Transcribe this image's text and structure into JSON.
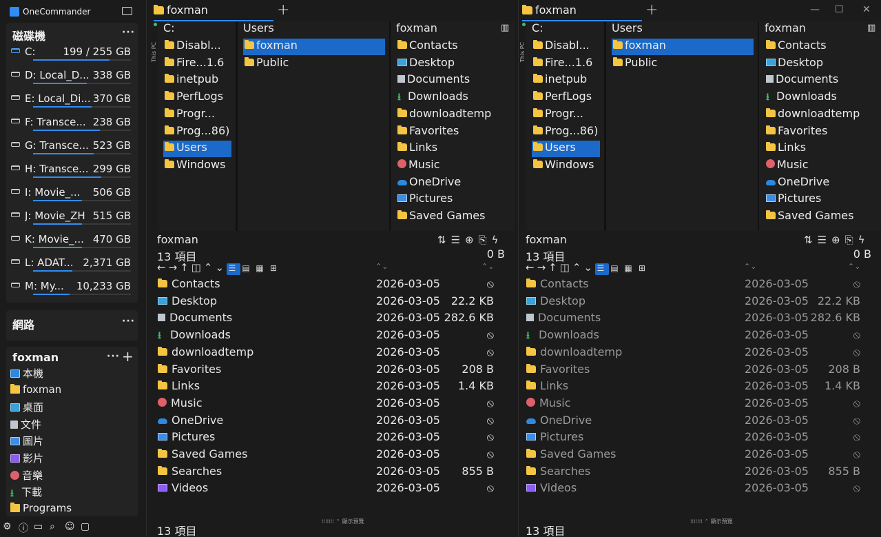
{
  "app": {
    "title": "OneCommander"
  },
  "sidebar": {
    "drives_title": "磁碟機",
    "drives": [
      {
        "label": "C:",
        "size": "199 / 255 GB",
        "fill": 0.78,
        "system": true
      },
      {
        "label": "D: Local_D...",
        "size": "338 GB",
        "fill": 0.55
      },
      {
        "label": "E: Local_Di...",
        "size": "370 GB",
        "fill": 0.6
      },
      {
        "label": "F: Transce...",
        "size": "238 GB",
        "fill": 0.68
      },
      {
        "label": "G: Transce...",
        "size": "523 GB",
        "fill": 0.62
      },
      {
        "label": "H: Transce...",
        "size": "299 GB",
        "fill": 0.7
      },
      {
        "label": "I:  Movie_...",
        "size": "506 GB",
        "fill": 0.5
      },
      {
        "label": "J:  Movie_ZH",
        "size": "515 GB",
        "fill": 0.5
      },
      {
        "label": "K: Movie_...",
        "size": "470 GB",
        "fill": 0.5
      },
      {
        "label": "L: ADAT...",
        "size": "2,371 GB",
        "fill": 0.4
      },
      {
        "label": "M: My...",
        "size": "10,233 GB",
        "fill": 0.37
      }
    ],
    "network_title": "網路",
    "user_title": "foxman",
    "nav": [
      {
        "label": "本機",
        "icon": "pc"
      },
      {
        "label": "foxman",
        "icon": "fold"
      },
      {
        "label": "桌面",
        "icon": "desk"
      },
      {
        "label": "文件",
        "icon": "doc"
      },
      {
        "label": "圖片",
        "icon": "pic"
      },
      {
        "label": "影片",
        "icon": "vid"
      },
      {
        "label": "音樂",
        "icon": "music"
      },
      {
        "label": "下載",
        "icon": "dl"
      },
      {
        "label": "Programs",
        "icon": "fold"
      }
    ]
  },
  "pane": {
    "tab_label": "foxman",
    "col1_head": "C:",
    "col1_items": [
      {
        "label": "Disabl...",
        "icon": "fold"
      },
      {
        "label": "Fire...1.6",
        "icon": "fold"
      },
      {
        "label": "inetpub",
        "icon": "fold"
      },
      {
        "label": "PerfLogs",
        "icon": "fold"
      },
      {
        "label": "Progr...",
        "icon": "fold"
      },
      {
        "label": "Prog...86)",
        "icon": "fold"
      },
      {
        "label": "Users",
        "icon": "fold",
        "selected": true
      },
      {
        "label": "Windows",
        "icon": "fold"
      }
    ],
    "col2_head": "Users",
    "col2_items": [
      {
        "label": "foxman",
        "icon": "fold",
        "selected": true
      },
      {
        "label": "Public",
        "icon": "fold"
      }
    ],
    "col3_head": "foxman",
    "col3_items": [
      {
        "label": "Contacts",
        "icon": "fold"
      },
      {
        "label": "Desktop",
        "icon": "desk"
      },
      {
        "label": "Documents",
        "icon": "doc"
      },
      {
        "label": "Downloads",
        "icon": "dl"
      },
      {
        "label": "downloadtemp",
        "icon": "fold"
      },
      {
        "label": "Favorites",
        "icon": "fold"
      },
      {
        "label": "Links",
        "icon": "fold"
      },
      {
        "label": "Music",
        "icon": "music"
      },
      {
        "label": "OneDrive",
        "icon": "cloud"
      },
      {
        "label": "Pictures",
        "icon": "pic"
      },
      {
        "label": "Saved Games",
        "icon": "fold"
      }
    ],
    "this_pc": "This PC",
    "list_title": "foxman",
    "item_count": "13 項目",
    "total_size": "0 B",
    "preview_label": "顯示預覽",
    "files": [
      {
        "name": "Contacts",
        "date": "2026-03-05",
        "size": "⦸",
        "icon": "fold"
      },
      {
        "name": "Desktop",
        "date": "2026-03-05",
        "size": "22.2 KB",
        "icon": "desk"
      },
      {
        "name": "Documents",
        "date": "2026-03-05",
        "size": "282.6 KB",
        "icon": "doc"
      },
      {
        "name": "Downloads",
        "date": "2026-03-05",
        "size": "⦸",
        "icon": "dl"
      },
      {
        "name": "downloadtemp",
        "date": "2026-03-05",
        "size": "⦸",
        "icon": "fold"
      },
      {
        "name": "Favorites",
        "date": "2026-03-05",
        "size": "208 B",
        "icon": "fold"
      },
      {
        "name": "Links",
        "date": "2026-03-05",
        "size": "1.4 KB",
        "icon": "fold"
      },
      {
        "name": "Music",
        "date": "2026-03-05",
        "size": "⦸",
        "icon": "music"
      },
      {
        "name": "OneDrive",
        "date": "2026-03-05",
        "size": "⦸",
        "icon": "cloud"
      },
      {
        "name": "Pictures",
        "date": "2026-03-05",
        "size": "⦸",
        "icon": "pic"
      },
      {
        "name": "Saved Games",
        "date": "2026-03-05",
        "size": "⦸",
        "icon": "fold"
      },
      {
        "name": "Searches",
        "date": "2026-03-05",
        "size": "855 B",
        "icon": "fold"
      },
      {
        "name": "Videos",
        "date": "2026-03-05",
        "size": "⦸",
        "icon": "vid"
      }
    ]
  }
}
